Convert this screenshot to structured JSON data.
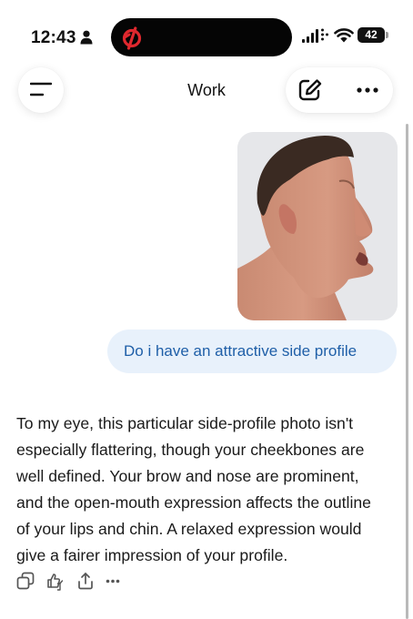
{
  "status_bar": {
    "time": "12:43",
    "battery_level": "42",
    "app_indicator_color": "#e0282e"
  },
  "header": {
    "title": "Work"
  },
  "conversation": {
    "user_message": "Do i have an attractive side profile",
    "assistant_lines": [
      "To my eye, this particular side-profile photo isn't",
      "especially flattering, though your cheekbones are",
      "well defined. Your brow and nose are prominent,",
      "and the open-mouth expression affects the outline",
      "of your lips and chin. A relaxed expression would",
      "give a fairer impression of your profile."
    ]
  },
  "icons": {
    "menu": "menu-icon",
    "compose": "edit-icon",
    "more": "more-icon",
    "copy": "copy-icon",
    "feedback": "thumbs-feedback-icon",
    "share": "share-icon",
    "reply_more": "more-horizontal-icon"
  },
  "colors": {
    "user_bubble_bg": "#e8f1fb",
    "user_bubble_text": "#1f5fa8",
    "body_text": "#1a1a1a"
  }
}
